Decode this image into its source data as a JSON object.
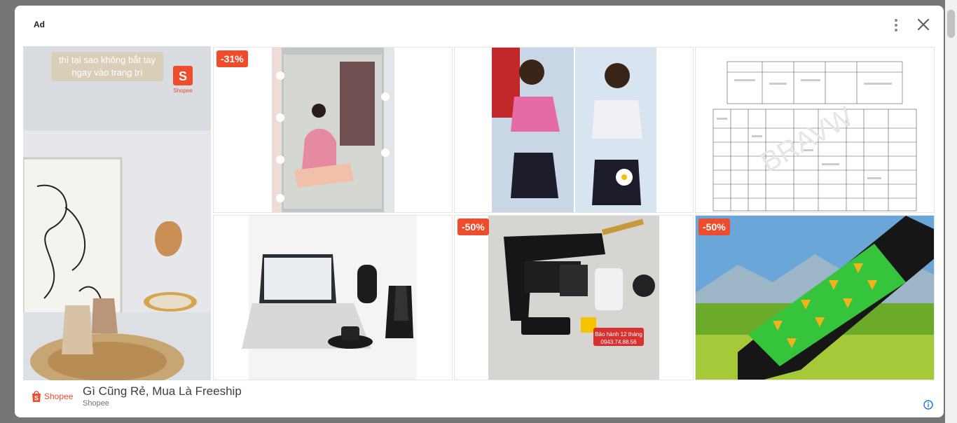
{
  "ad": {
    "label": "Ad",
    "headline": "Gì Cũng Rẻ, Mua Là Freeship",
    "advertiser": "Shopee",
    "brand_logo_text": "Shopee"
  },
  "tiles": [
    {
      "overlay_line1": "thì tại sao không bắt tay",
      "overlay_line2": "ngay vào trang trí",
      "logo_text": "Shopee"
    },
    {
      "badge": "-31%"
    },
    {},
    {},
    {},
    {
      "badge": "-50%",
      "caption_line1": "Bảo hành 12 tháng",
      "caption_line2": "0943.74.88.56"
    },
    {
      "badge": "-50%"
    }
  ],
  "icons": {
    "menu": "more-vert-icon",
    "close": "close-icon",
    "info": "info-icon",
    "logo": "shopee-bag-icon"
  },
  "colors": {
    "brand": "#ee4d2d",
    "info": "#1a73e8"
  }
}
